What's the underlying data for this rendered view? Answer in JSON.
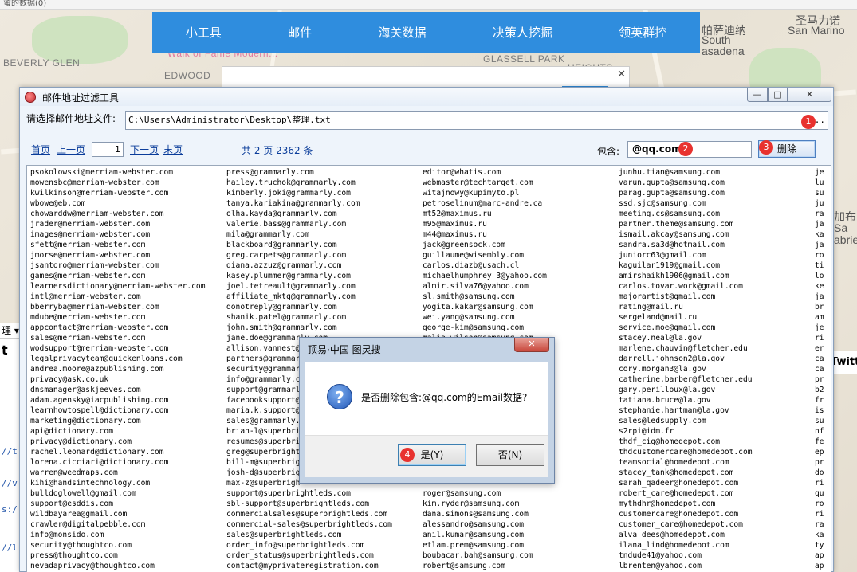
{
  "background": {
    "top_strip": "蜜的数据(0)",
    "map_labels": [
      "BEVERLY GLEN",
      "Walk of Fame Modern...",
      "GLASSELL PARK",
      "HEIGHTS",
      "EDWOOD",
      "圣马力诺",
      "San Marino",
      "帕萨迪纳",
      "South",
      "asadena",
      "加布",
      "Sa",
      "abriel"
    ],
    "left_toolbar": "理 ▾",
    "left_title": "t",
    "left_links": [
      "//t",
      "//v",
      "s:/",
      "//l"
    ],
    "right_fragment": "Twitt",
    "dialog_close": "✕"
  },
  "navbar": {
    "items": [
      "小工具",
      "邮件",
      "海关数据",
      "决策人挖掘",
      "领英群控"
    ]
  },
  "window": {
    "title": "邮件地址过滤工具",
    "controls": {
      "min": "—",
      "max": "□",
      "close": "✕"
    },
    "file_label": "请选择邮件地址文件:",
    "file_path": "C:\\Users\\Administrator\\Desktop\\整理.txt",
    "browse": "...",
    "pager": {
      "first": "首页",
      "prev": "上一页",
      "page": "1",
      "next": "下一页",
      "last": "末页"
    },
    "total_text": "共 2 页 2362 条",
    "include_label": "包含:",
    "include_value": "@qq.com",
    "delete_button": "删除",
    "callouts": [
      "1",
      "2",
      "3",
      "4"
    ],
    "columns": [
      [
        "psokolowski@merriam-webster.com",
        "mowensbc@merriam-webster.com",
        "kwilkinson@merriam-webster.com",
        "wbowe@eb.com",
        "chowarddw@merriam-webster.com",
        "jrader@merriam-webster.com",
        "images@merriam-webster.com",
        "sfett@merriam-webster.com",
        "jmorse@merriam-webster.com",
        "jsantoro@merriam-webster.com",
        "games@merriam-webster.com",
        "learnersdictionary@merriam-webster.com",
        "intl@merriam-webster.com",
        "bberryba@merriam-webster.com",
        "mdube@merriam-webster.com",
        "appcontact@merriam-webster.com",
        "sales@merriam-webster.com",
        "wodsupport@merriam-webster.com",
        "legalprivacyteam@quickenloans.com",
        "andrea.moore@azpublishing.com",
        "privacy@ask.co.uk",
        "dnsmanager@askjeeves.com",
        "adam.agensky@iacpublishing.com",
        "learnhowtospell@dictionary.com",
        "marketing@dictionary.com",
        "api@dictionary.com",
        "privacy@dictionary.com",
        "rachel.leonard@dictionary.com",
        "lorena.cicciari@dictionary.com",
        "warren@weedmaps.com",
        "kihi@handsintechnology.com",
        "bulldoglowell@gmail.com",
        "support@esddis.com",
        "wildbayarea@gmail.com",
        "crawler@digitalpebble.com",
        "info@monsido.com",
        "security@thoughtco.com",
        "press@thoughtco.com",
        "nevadaprivacy@thoughtco.com"
      ],
      [
        "press@grammarly.com",
        "hailey.truchok@grammarly.com",
        "kimberly.joki@grammarly.com",
        "tanya.kariakina@grammarly.com",
        "olha.kayda@grammarly.com",
        "valerie.bass@grammarly.com",
        "mila@grammarly.com",
        "blackboard@grammarly.com",
        "greg.carpets@grammarly.com",
        "diana.azzuz@grammarly.com",
        "kasey.plummer@grammarly.com",
        "joel.tetreault@grammarly.com",
        "affiliate_mktg@grammarly.com",
        "donotreply@grammarly.com",
        "shanik.patel@grammarly.com",
        "john.smith@grammarly.com",
        "jane.doe@grammarly.com",
        "allison.vannest@gra",
        "partners@grammar",
        "security@grammar",
        "info@grammarly.c",
        "support@grammarl",
        "facebooksupport@",
        "maria.k.support@",
        "sales@grammarly.",
        "brian-l@superbri",
        "resumes@superbri",
        "greg@superbright",
        "bill-m@superbrig",
        "josh-d@superbrig",
        "max-z@superbrigh",
        "support@superbrightleds.com",
        "sbl-support@superbrightleds.com",
        "commercialsales@superbrightleds.com",
        "commercial-sales@superbrightleds.com",
        "sales@superbrightleds.com",
        "order_info@superbrightleds.com",
        "order_status@superbrightleds.com",
        "contact@myprivateregistration.com"
      ],
      [
        "editor@whatis.com",
        "webmaster@techtarget.com",
        "witajnowy@kupimyto.pl",
        "petroselinum@marc-andre.ca",
        "mt52@maximus.ru",
        "m95@maximus.ru",
        "m44@maximus.ru",
        "jack@greensock.com",
        "guillaume@wisembly.com",
        "carlos.diazb@usach.cl",
        "michaelhumphrey_3@yahoo.com",
        "almir.silva76@yahoo.com",
        "sl.smith@samsung.com",
        "yogita.kakar@samsung.com",
        "wei.yang@samsung.com",
        "george-kim@samsung.com",
        "malia.wilson@samsung.com",
        "",
        "",
        "",
        "",
        "",
        "",
        "",
        "",
        "",
        "",
        "",
        "",
        "",
        "",
        "roger@samsung.com",
        "kim.ryder@samsung.com",
        "dana.simons@samsung.com",
        "alessandro@samsung.com",
        "anil.kumar@samsung.com",
        "etlam.prem@samsung.com",
        "boubacar.bah@samsung.com",
        "robert@samsung.com"
      ],
      [
        "junhu.tian@samsung.com",
        "varun.gupta@samsung.com",
        "parag.gupta@samsung.com",
        "ssd.sjc@samsung.com",
        "meeting.cs@samsung.com",
        "partner.theme@samsung.com",
        "ismail.akcay@samsung.com",
        "sandra.sa3d@hotmail.com",
        "juniorc63@gmail.com",
        "kaguilar1919@gmail.com",
        "amirshaikh1906@gmail.com",
        "carlos.tovar.work@gmail.com",
        "majorartist@gmail.com",
        "rating@mail.ru",
        "sergeland@mail.ru",
        "service.moe@gmail.com",
        "stacey.neal@la.gov",
        "marlene.chauvin@fletcher.edu",
        "darrell.johnson2@la.gov",
        "cory.morgan3@la.gov",
        "catherine.barber@fletcher.edu",
        "gary.perilloux@la.gov",
        "tatiana.bruce@la.gov",
        "stephanie.hartman@la.gov",
        "sales@ledsupply.com",
        "s2rpi@idm.fr",
        "thdf_cig@homedepot.com",
        "thdcustomercare@homedepot.com",
        "teamsocial@homedepot.com",
        "stacey_tank@homedepot.com",
        "sarah_qadeer@homedepot.com",
        "robert_care@homedepot.com",
        "mythdhr@homedepot.com",
        "customercare@homedepot.com",
        "customer_care@homedepot.com",
        "alva_dees@homedepot.com",
        "ilana_lind@homedepot.com",
        "tndude41@yahoo.com",
        "lbrenten@yahoo.com"
      ],
      [
        "je",
        "lu",
        "su",
        "ju",
        "ra",
        "ja",
        "ka",
        "ja",
        "ro",
        "ti",
        "lo",
        "ke",
        "ja",
        "br",
        "am",
        "je",
        "ri",
        "er",
        "ca",
        "ca",
        "pr",
        "b2",
        "fr",
        "is",
        "su",
        "nf",
        "fe",
        "ep",
        "pr",
        "do",
        "ri",
        "qu",
        "ro",
        "ri",
        "ra",
        "ka",
        "ty",
        "ap",
        "ap"
      ]
    ]
  },
  "modal": {
    "title": "顶易·中国 图灵搜",
    "close": "✕",
    "icon": "?",
    "message": "是否删除包含:@qq.com的Email数据?",
    "yes": "是(Y)",
    "no": "否(N)"
  }
}
